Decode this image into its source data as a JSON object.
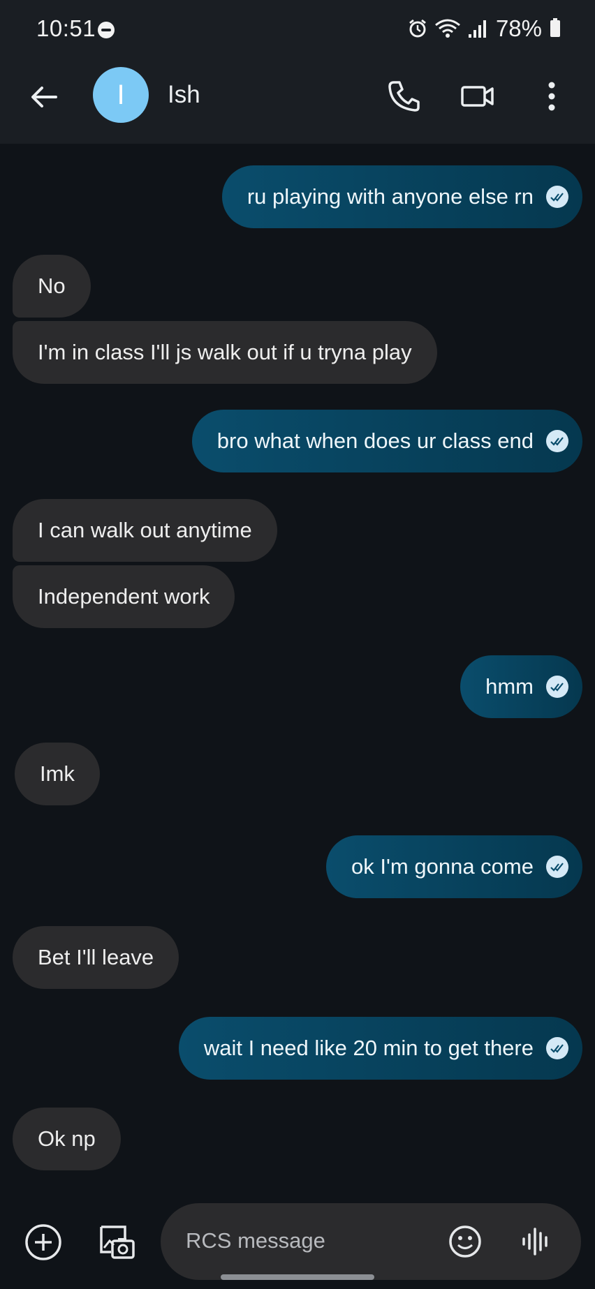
{
  "status_bar": {
    "time": "10:51",
    "battery": "78%",
    "icons": [
      "do-not-disturb-icon",
      "alarm-icon",
      "wifi-icon",
      "signal-icon",
      "battery-icon"
    ]
  },
  "header": {
    "avatar_letter": "I",
    "contact_name": "Ish",
    "avatar_color": "#7cc9f5"
  },
  "messages": [
    {
      "from": "me",
      "text": "ru playing with anyone else rn"
    },
    {
      "from": "them",
      "text": "No"
    },
    {
      "from": "them",
      "text": "I'm in class I'll js walk out if u tryna play"
    },
    {
      "from": "me",
      "text": "bro what when does ur class end"
    },
    {
      "from": "them",
      "text": "I can walk out anytime"
    },
    {
      "from": "them",
      "text": "Independent work"
    },
    {
      "from": "me",
      "text": "hmm"
    },
    {
      "from": "them",
      "text": "Imk"
    },
    {
      "from": "me",
      "text": "ok I'm gonna come"
    },
    {
      "from": "them",
      "text": "Bet I'll leave"
    },
    {
      "from": "me",
      "text": "wait I need like 20 min to get there"
    },
    {
      "from": "them",
      "text": "Ok np"
    }
  ],
  "composer": {
    "placeholder": "RCS message"
  },
  "colors": {
    "background": "#0f1318",
    "incoming_bubble": "#2b2b2d",
    "outgoing_bubble": "#0a4d6c"
  }
}
